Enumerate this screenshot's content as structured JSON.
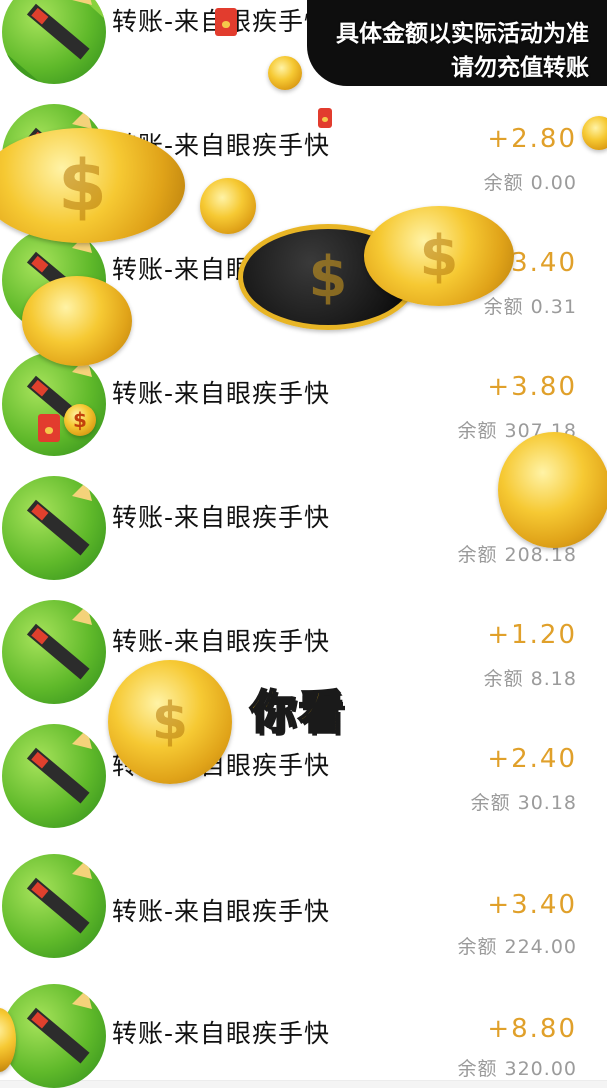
{
  "notice": {
    "line1": "具体金额以实际活动为准",
    "line2": "请勿充值转账"
  },
  "caption": "你看",
  "transactions": [
    {
      "title": "转账-来自眼疾手快",
      "amount": "",
      "balance": ""
    },
    {
      "title": "转账-来自眼疾手快",
      "amount": "+2.80",
      "balance": "余额 0.00"
    },
    {
      "title": "转账-来自眼疾手快",
      "amount": "+3.40",
      "balance": "余额 0.31"
    },
    {
      "title": "转账-来自眼疾手快",
      "amount": "+3.80",
      "balance": "余额 307.18"
    },
    {
      "title": "转账-来自眼疾手快",
      "amount": "",
      "balance": "余额 208.18"
    },
    {
      "title": "转账-来自眼疾手快",
      "amount": "+1.20",
      "balance": "余额 8.18"
    },
    {
      "title": "转账-来自眼疾手快",
      "amount": "+2.40",
      "balance": "余额 30.18"
    },
    {
      "title": "转账-来自眼疾手快",
      "amount": "+3.40",
      "balance": "余额 224.00"
    },
    {
      "title": "转账-来自眼疾手快",
      "amount": "+8.80",
      "balance": "余额 320.00"
    }
  ],
  "colors": {
    "amount": "#e0a02a",
    "balance": "#9b9b9b",
    "caption": "#f7c21a",
    "avatar_bg": "#5fb92a"
  },
  "icons": {
    "avatar": "sword-avatar-icon",
    "coin": "gold-coin-icon",
    "red_packet": "red-packet-icon"
  }
}
